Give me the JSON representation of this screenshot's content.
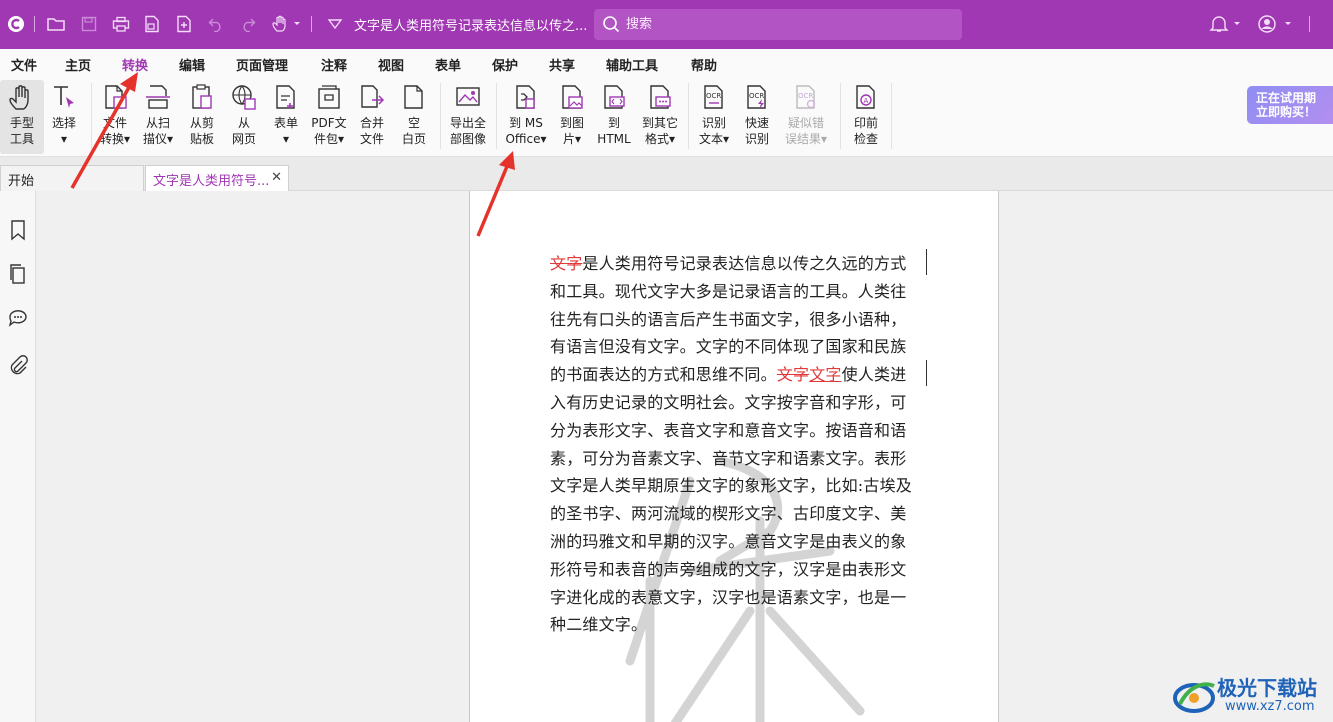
{
  "titlebar": {
    "doc_title": "文字是人类用符号记录表达信息以传之...",
    "search_placeholder": "搜索",
    "accent": "#a037b3"
  },
  "menu": {
    "items": [
      "文件",
      "主页",
      "转换",
      "编辑",
      "页面管理",
      "注释",
      "视图",
      "表单",
      "保护",
      "共享",
      "辅助工具",
      "帮助"
    ],
    "active": "转换"
  },
  "ribbon": {
    "hand": "手型\n工具",
    "select": "选择\n▾",
    "file_convert": "文件\n转换▾",
    "from_scanner": "从扫\n描仪▾",
    "from_clipboard": "从剪\n贴板",
    "from_web": "从\n网页",
    "form": "表单\n▾",
    "pdf_package": "PDF文\n件包▾",
    "merge_files": "合并\n文件",
    "blank_page": "空\n白页",
    "export_images": "导出全\n部图像",
    "to_ms_office": "到 MS\nOffice▾",
    "to_image": "到图\n片▾",
    "to_html": "到\nHTML",
    "to_other": "到其它\n格式▾",
    "ocr_text": "识别\n文本▾",
    "quick_ocr": "快速\n识别",
    "suspect_results": "疑似错\n误结果▾",
    "preflight": "印前\n检查",
    "trial_line1": "正在试用期",
    "trial_line2": "立即购买！"
  },
  "tabs": {
    "start": "开始",
    "doc": "文字是人类用符号...",
    "close": "✕"
  },
  "document": {
    "strike1": "文字",
    "p1": "是人类用符号记录表达信息以传之久远的方式和工具。现代文字大多是记录语言的工具。人类往往先有口头的语言后产生书面文字，很多小语种，有语言但没有文字。文字的不同体现了国家和民族的书面表达的方式和思维不同。",
    "strike2": "文字",
    "underline": "文字",
    "p2": "使人类进入有历史记录的文明社会。文字按字音和字形，可分为表形文字、表音文字和意音文字。按语音和语素，可分为音素文字、音节文字和语素文字。表形文字是人类早期原生文字的象形文字，比如:古埃及的圣书字、两河流域的楔形文字、古印度文字、美洲的玛雅文和早期的汉字。意音文字是由表义的象形符号和表音的声旁组成的文字，汉字是由表形文字进化成的表意文字，汉字也是语素文字，也是一种二维文字。"
  },
  "site_logo": {
    "name": "极光下载站",
    "url": "www.xz7.com"
  }
}
